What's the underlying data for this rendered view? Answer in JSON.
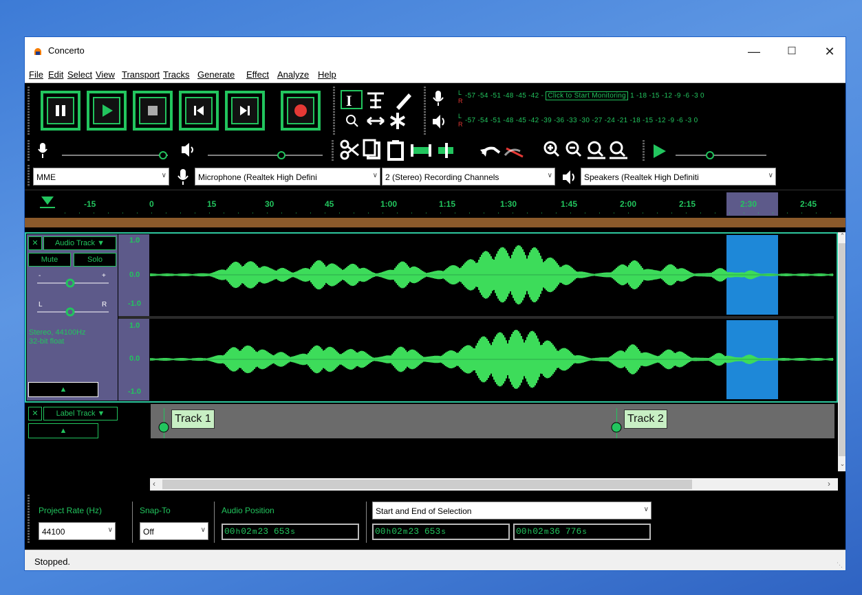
{
  "window": {
    "title": "Concerto"
  },
  "menu": [
    "File",
    "Edit",
    "Select",
    "View",
    "Transport",
    "Tracks",
    "Generate",
    "Effect",
    "Analyze",
    "Help"
  ],
  "transport": {
    "buttons": [
      "pause",
      "play",
      "stop",
      "skip-to-start",
      "skip-to-end",
      "record"
    ]
  },
  "meters": {
    "record_scale": "-57 -54 -51 -48 -45 -42 -",
    "monitor_text": "Click to Start Monitoring",
    "record_scale_tail": "1 -18 -15 -12 -9 -6 -3 0",
    "playback_scale": "-57 -54 -51 -48 -45 -42 -39 -36 -33 -30 -27 -24 -21 -18 -15 -12 -9 -6 -3 0",
    "channel_l": "L",
    "channel_r": "R"
  },
  "device": {
    "host": "MME",
    "recording_device": "Microphone (Realtek High Defini",
    "channels": "2 (Stereo) Recording Channels",
    "playback_device": "Speakers (Realtek High Definiti"
  },
  "ruler": {
    "labels": [
      "-15",
      "0",
      "15",
      "30",
      "45",
      "1:00",
      "1:15",
      "1:30",
      "1:45",
      "2:00",
      "2:15",
      "2:30",
      "2:45"
    ]
  },
  "audio_track": {
    "name": "Audio Track",
    "mute": "Mute",
    "solo": "Solo",
    "gain_minus": "-",
    "gain_plus": "+",
    "pan_left": "L",
    "pan_right": "R",
    "info_line1": "Stereo, 44100Hz",
    "info_line2": "32-bit float",
    "scale": [
      "1.0",
      "0.0",
      "-1.0",
      "1.0",
      "0.0",
      "-1.0"
    ]
  },
  "label_track": {
    "name": "Label Track",
    "labels": [
      "Track 1",
      "Track 2"
    ]
  },
  "selection_toolbar": {
    "project_rate_label": "Project Rate (Hz)",
    "project_rate": "44100",
    "snap_label": "Snap-To",
    "snap": "Off",
    "audio_position_label": "Audio Position",
    "selection_mode": "Start and End of Selection",
    "audio_position": [
      "00",
      "h",
      "02",
      "m",
      "23",
      "653",
      "s"
    ],
    "sel_start": [
      "00",
      "h",
      "02",
      "m",
      "23",
      "653",
      "s"
    ],
    "sel_end": [
      "00",
      "h",
      "02",
      "m",
      "36",
      "776",
      "s"
    ]
  },
  "status": {
    "text": "Stopped."
  },
  "colors": {
    "accent": "#22c55e",
    "selection": "#1e88d8",
    "track_bg": "#5d5a8a",
    "timeline_bar": "#8b5a2b"
  }
}
